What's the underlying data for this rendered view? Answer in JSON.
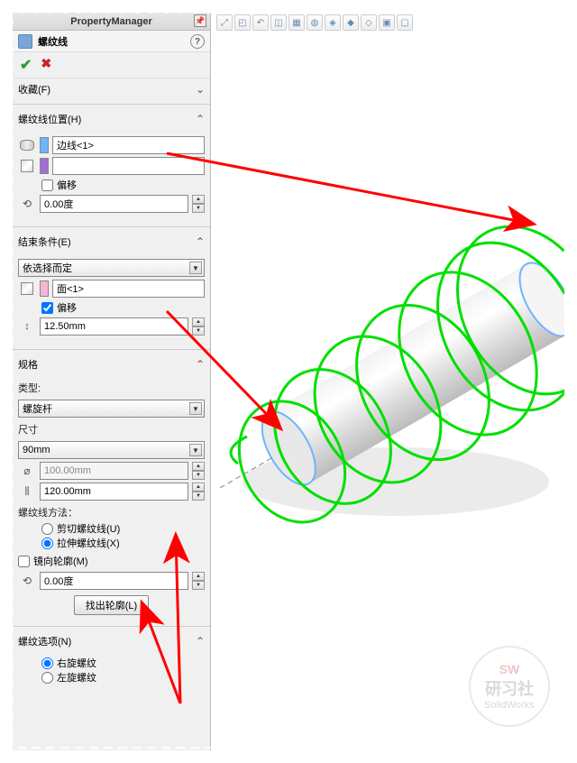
{
  "pm": {
    "title": "PropertyManager",
    "feature_name": "螺纹线",
    "help": "?"
  },
  "favorites": {
    "header": "收藏(F)"
  },
  "position": {
    "header": "螺纹线位置(H)",
    "edge_value": "边线<1>",
    "face_value": "",
    "offset_label": "偏移",
    "angle_value": "0.00度"
  },
  "end_cond": {
    "header": "结束条件(E)",
    "type_value": "依选择而定",
    "face_value": "面<1>",
    "offset_label": "偏移",
    "offset_checked": true,
    "offset_value": "12.50mm"
  },
  "spec": {
    "header": "规格",
    "type_label": "类型:",
    "type_value": "螺旋杆",
    "size_label": "尺寸",
    "size_value": "90mm",
    "diameter_value": "100.00mm",
    "pitch_value": "120.00mm",
    "method_label": "螺纹线方法：",
    "method_cut": "剪切螺纹线(U)",
    "method_extrude": "拉伸螺纹线(X)",
    "mirror_label": "镜向轮廓(M)",
    "angle2_value": "0.00度",
    "find_profile_btn": "找出轮廓(L)"
  },
  "options": {
    "header": "螺纹选项(N)",
    "right_hand": "右旋螺纹",
    "left_hand": "左旋螺纹"
  },
  "watermark": {
    "sw": "SW",
    "main": "研习社",
    "sub": "SolidWorks"
  }
}
